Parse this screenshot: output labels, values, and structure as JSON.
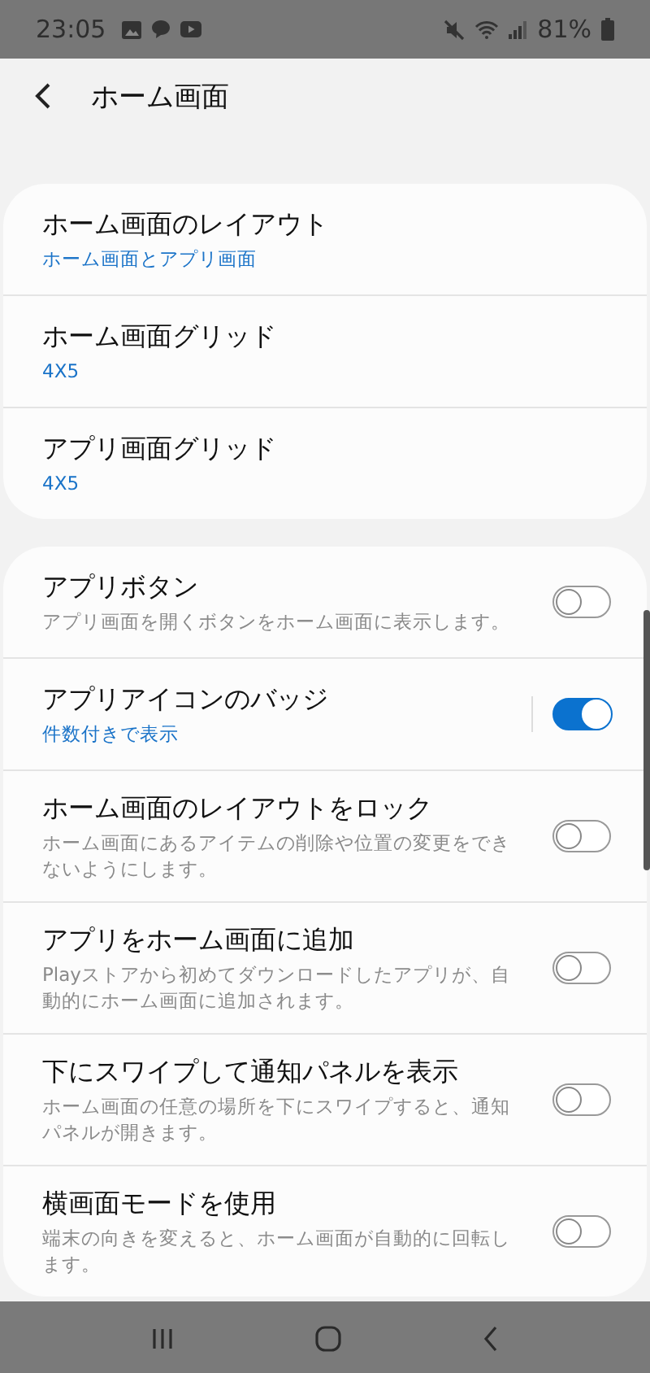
{
  "status_bar": {
    "time": "23:05",
    "battery": "81%"
  },
  "header": {
    "title": "ホーム画面"
  },
  "groups": [
    {
      "items": [
        {
          "title": "ホーム画面のレイアウト",
          "value": "ホーム画面とアプリ画面"
        },
        {
          "title": "ホーム画面グリッド",
          "value": "4X5"
        },
        {
          "title": "アプリ画面グリッド",
          "value": "4X5"
        }
      ]
    },
    {
      "items": [
        {
          "title": "アプリボタン",
          "description": "アプリ画面を開くボタンをホーム画面に表示します。",
          "on": false
        },
        {
          "title": "アプリアイコンのバッジ",
          "value": "件数付きで表示",
          "on": true
        },
        {
          "title": "ホーム画面のレイアウトをロック",
          "description": "ホーム画面にあるアイテムの削除や位置の変更をできないようにします。",
          "on": false
        },
        {
          "title": "アプリをホーム画面に追加",
          "description": "Playストアから初めてダウンロードしたアプリが、自動的にホーム画面に追加されます。",
          "on": false
        },
        {
          "title": "下にスワイプして通知パネルを表示",
          "description": "ホーム画面の任意の場所を下にスワイプすると、通知パネルが開きます。",
          "on": false
        },
        {
          "title": "横画面モードを使用",
          "description": "端末の向きを変えると、ホーム画面が自動的に回転します。",
          "on": false
        }
      ]
    }
  ]
}
